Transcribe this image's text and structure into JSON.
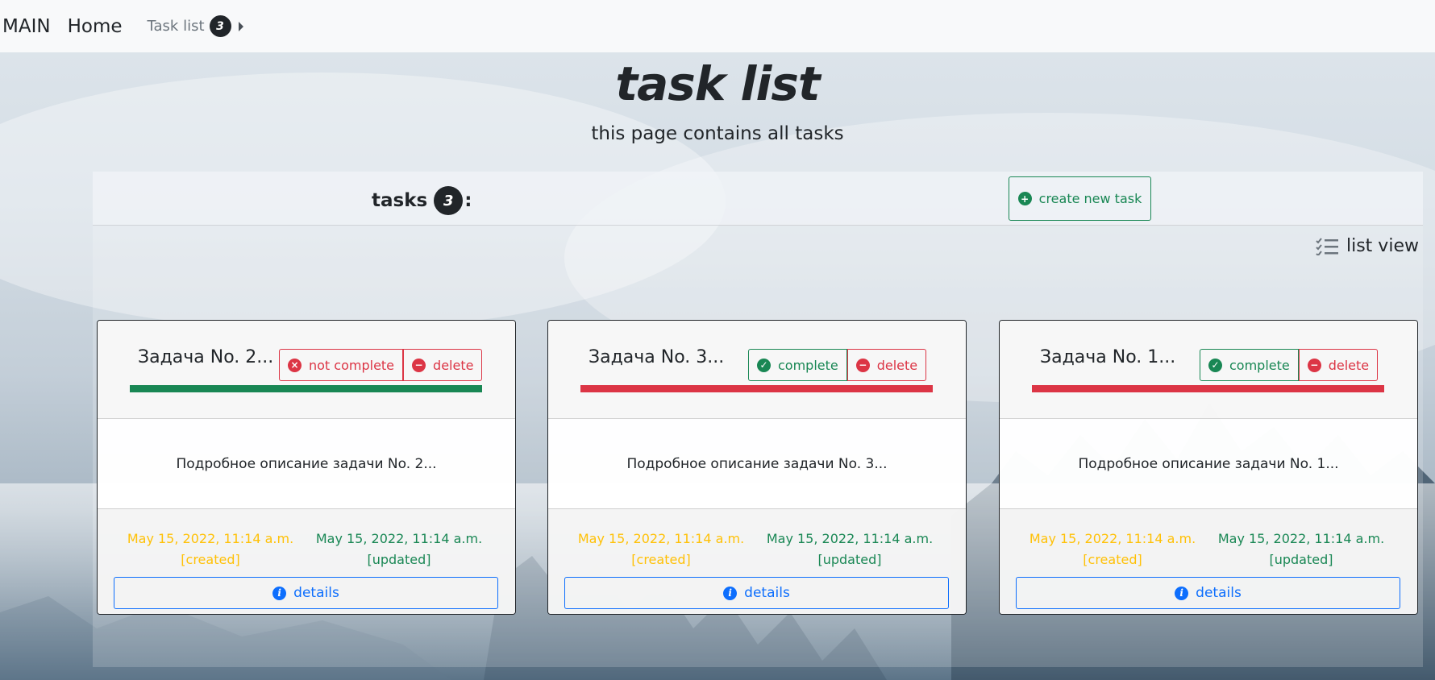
{
  "navbar": {
    "brand": "MAIN",
    "home": "Home",
    "task_list": "Task list",
    "task_count": "3"
  },
  "header": {
    "title": "task list",
    "subtitle": "this page contains all tasks"
  },
  "panel": {
    "tasks_label": "tasks",
    "tasks_count": "3",
    "tasks_suffix": ":",
    "create_button": "create new task",
    "list_view": "list view"
  },
  "cards": [
    {
      "title": "Задача No. 2...",
      "status_button": "not complete",
      "delete_button": "delete",
      "description": "Подробное описание задачи No. 2...",
      "created_date": "May 15, 2022, 11:14 a.m.",
      "created_label": "[created]",
      "updated_date": "May 15, 2022, 11:14 a.m.",
      "updated_label": "[updated]",
      "details_button": "details"
    },
    {
      "title": "Задача No. 3...",
      "status_button": "complete",
      "delete_button": "delete",
      "description": "Подробное описание задачи No. 3...",
      "created_date": "May 15, 2022, 11:14 a.m.",
      "created_label": "[created]",
      "updated_date": "May 15, 2022, 11:14 a.m.",
      "updated_label": "[updated]",
      "details_button": "details"
    },
    {
      "title": "Задача No. 1...",
      "status_button": "complete",
      "delete_button": "delete",
      "description": "Подробное описание задачи No. 1...",
      "created_date": "May 15, 2022, 11:14 a.m.",
      "created_label": "[created]",
      "updated_date": "May 15, 2022, 11:14 a.m.",
      "updated_label": "[updated]",
      "details_button": "details"
    }
  ],
  "colors": {
    "success": "#198754",
    "danger": "#dc3545",
    "warning": "#ffc107",
    "primary": "#0d6efd",
    "dark": "#212529"
  },
  "icons": {
    "create": "plus-circle-icon",
    "not_complete": "x-circle-icon",
    "complete": "check-circle-icon",
    "delete": "minus-circle-icon",
    "details": "info-circle-icon",
    "list_view": "list-check-icon",
    "caret": "caret-right-icon"
  }
}
